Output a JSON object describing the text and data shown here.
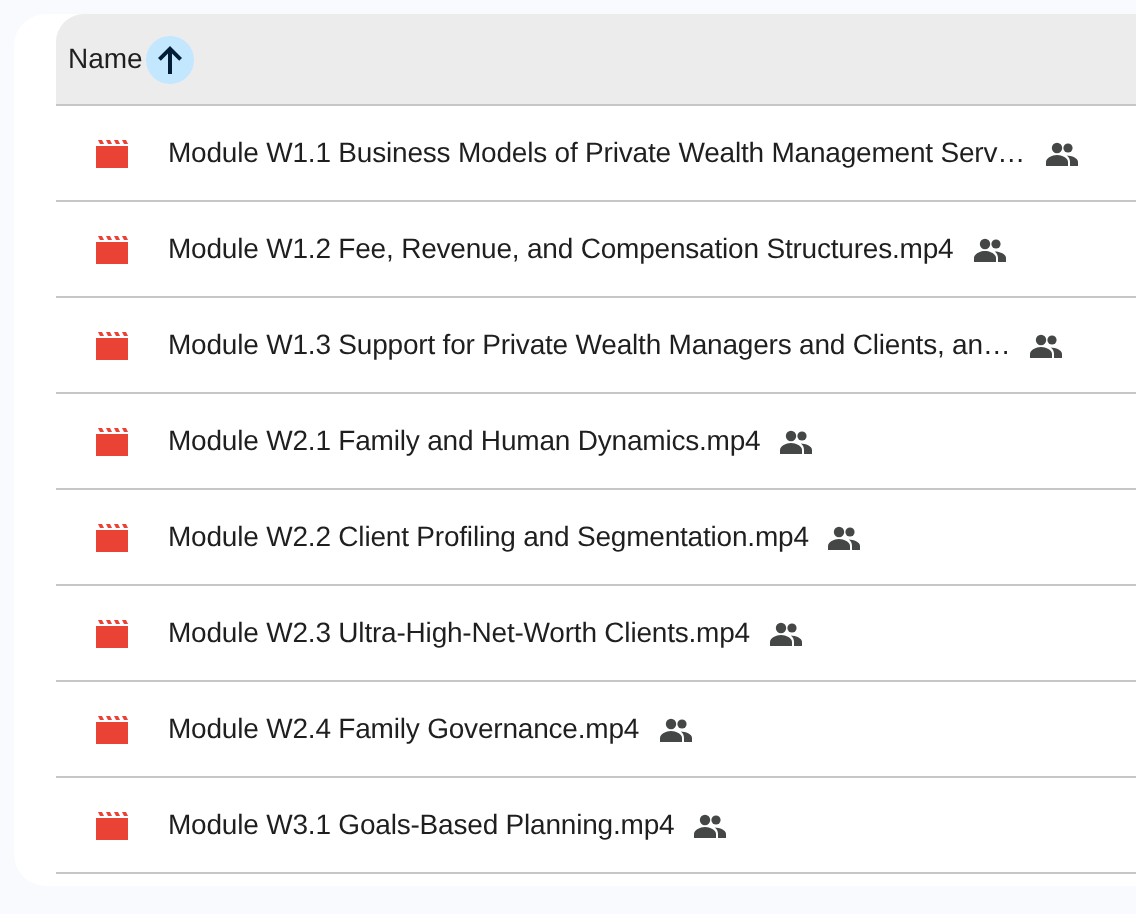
{
  "table": {
    "columns": [
      {
        "label": "Name",
        "ascending": true
      }
    ],
    "rows": [
      {
        "kind": "video",
        "name": "Module W1.1 Business Models of Private Wealth Management Serv…",
        "shared": true
      },
      {
        "kind": "video",
        "name": "Module W1.2 Fee, Revenue, and Compensation Structures.mp4",
        "shared": true
      },
      {
        "kind": "video",
        "name": "Module W1.3 Support for Private Wealth Managers and Clients, an…",
        "shared": true
      },
      {
        "kind": "video",
        "name": "Module W2.1 Family and Human Dynamics.mp4",
        "shared": true
      },
      {
        "kind": "video",
        "name": "Module W2.2 Client Profiling and Segmentation.mp4",
        "shared": true
      },
      {
        "kind": "video",
        "name": "Module W2.3 Ultra-High-Net-Worth Clients.mp4",
        "shared": true
      },
      {
        "kind": "video",
        "name": "Module W2.4 Family Governance.mp4",
        "shared": true
      },
      {
        "kind": "video",
        "name": "Module W3.1 Goals-Based Planning.mp4",
        "shared": true
      }
    ]
  }
}
